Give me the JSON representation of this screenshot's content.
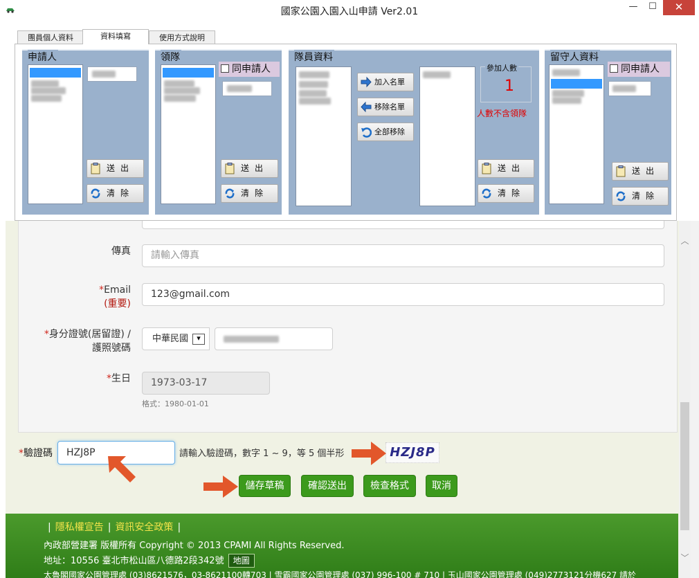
{
  "window": {
    "title": "國家公園入園入山申請 Ver2.01",
    "minimize_glyph": "—",
    "maximize_glyph": "☐",
    "close_glyph": "✕",
    "icon": "app-car-icon"
  },
  "tabs": [
    {
      "label": "團員個人資料",
      "active": false
    },
    {
      "label": "資料填寫",
      "active": true
    },
    {
      "label": "使用方式說明",
      "active": false
    }
  ],
  "groups": {
    "applicant": {
      "title": "申請人",
      "send_label": "送出",
      "clear_label": "清除"
    },
    "leader": {
      "title": "領隊",
      "same_as_applicant": "同申請人",
      "send_label": "送出",
      "clear_label": "清除"
    },
    "members": {
      "title": "隊員資料",
      "add_label": "加入名單",
      "remove_label": "移除名單",
      "remove_all_label": "全部移除",
      "count_label": "參加人數",
      "count_value": "1",
      "count_note": "人數不含領隊",
      "send_label": "送出",
      "clear_label": "清除"
    },
    "guardian": {
      "title": "留守人資料",
      "same_as_applicant": "同申請人",
      "send_label": "送出",
      "clear_label": "清除"
    }
  },
  "form": {
    "fax": {
      "label": "傳真",
      "placeholder": "請輸入傳真"
    },
    "email": {
      "required_mark": "*",
      "label": "Email",
      "note": "(重要)",
      "value": "123@gmail.com"
    },
    "id_number": {
      "required_mark": "*",
      "label_line1": "身分證號(居留證) /",
      "label_line2": "護照號碼",
      "country": "中華民國"
    },
    "birthday": {
      "required_mark": "*",
      "label": "生日",
      "value": "1973-03-17",
      "hint": "格式：1980-01-01"
    }
  },
  "captcha": {
    "required_mark": "*",
    "label": "驗證碼",
    "value": "HZJ8P",
    "hint": "請輸入驗證碼，數字 1 ~ 9，等 5 個半形",
    "image_text": "HZJ8P"
  },
  "actions": {
    "save_draft": "儲存草稿",
    "confirm_submit": "確認送出",
    "check_format": "檢查格式",
    "cancel": "取消"
  },
  "footer": {
    "privacy": "隱私權宣告",
    "security": "資訊安全政策",
    "copyright": "內政部營建署 版權所有 Copyright © 2013 CPAMI All Rights Reserved.",
    "address": "地址：10556 臺北市松山區八德路2段342號",
    "map": "地圖",
    "offices": "太魯閣國家公園管理處 (03)8621576，03-8621100轉703 | 雪霸國家公園管理處 (037) 996-100 # 710 | 玉山國家公園管理處 (049)2773121分機627 請於"
  },
  "colors": {
    "group_bg": "#9ab1cc",
    "annotation_arrow": "#e2572b",
    "action_button": "#3c9a1c",
    "footer_green": "#3a8a22",
    "link_yellow": "#f2e34a"
  }
}
